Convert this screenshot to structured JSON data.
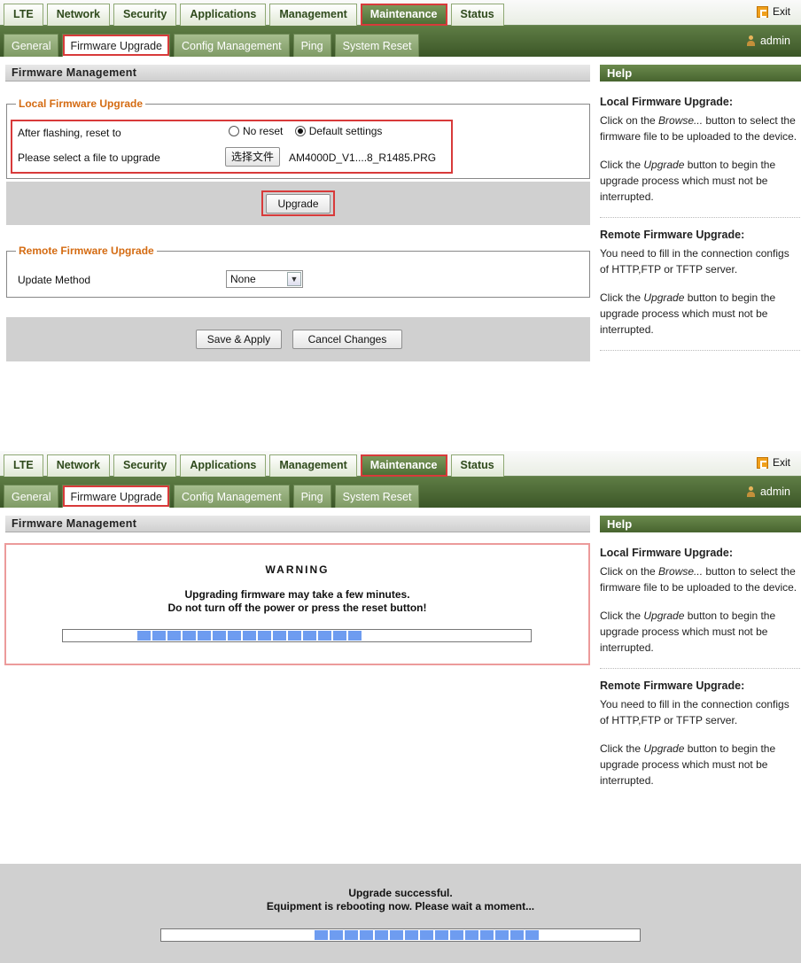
{
  "nav": {
    "top_tabs": [
      "LTE",
      "Network",
      "Security",
      "Applications",
      "Management",
      "Maintenance",
      "Status"
    ],
    "sub_tabs": [
      "General",
      "Firmware Upgrade",
      "Config Management",
      "Ping",
      "System Reset"
    ],
    "exit_label": "Exit",
    "user_label": "admin"
  },
  "panel": {
    "title": "Firmware Management"
  },
  "help": {
    "title": "Help",
    "local_heading": "Local Firmware Upgrade:",
    "local_p1_a": "Click on the ",
    "local_p1_em": "Browse...",
    "local_p1_b": " button to select the firmware file to be uploaded to the device.",
    "local_p2_a": "Click the ",
    "local_p2_em": "Upgrade",
    "local_p2_b": " button to begin the upgrade process which must not be interrupted.",
    "remote_heading": "Remote Firmware Upgrade:",
    "remote_p1": "You need to fill in the connection configs of HTTP,FTP or TFTP server.",
    "remote_p2_a": "Click the ",
    "remote_p2_em": "Upgrade",
    "remote_p2_b": " button to begin the upgrade process which must not be interrupted."
  },
  "local_upgrade": {
    "legend": "Local Firmware Upgrade",
    "reset_label": "After flashing, reset to",
    "option_no_reset": "No reset",
    "option_default": "Default settings",
    "file_label": "Please select a file to upgrade",
    "choose_file_button": "选择文件",
    "file_name": "AM4000D_V1....8_R1485.PRG",
    "upgrade_button": "Upgrade"
  },
  "remote_upgrade": {
    "legend": "Remote Firmware Upgrade",
    "method_label": "Update Method",
    "method_value": "None"
  },
  "actions": {
    "save": "Save & Apply",
    "cancel": "Cancel Changes"
  },
  "warning": {
    "title": "WARNING",
    "line1": "Upgrading firmware may take a few minutes.",
    "line2": "Do not turn off the power or press the reset button!",
    "progress_segments": {
      "start": 0.16,
      "end": 0.64
    }
  },
  "success": {
    "line1": "Upgrade successful.",
    "line2": "Equipment is rebooting now. Please wait a moment...",
    "progress_segments": {
      "start": 0.32,
      "end": 0.8
    }
  },
  "colors": {
    "accent": "#4b6a33",
    "highlight": "#d83a3a",
    "progress": "#6e9cf0",
    "legend": "#d46b12"
  }
}
